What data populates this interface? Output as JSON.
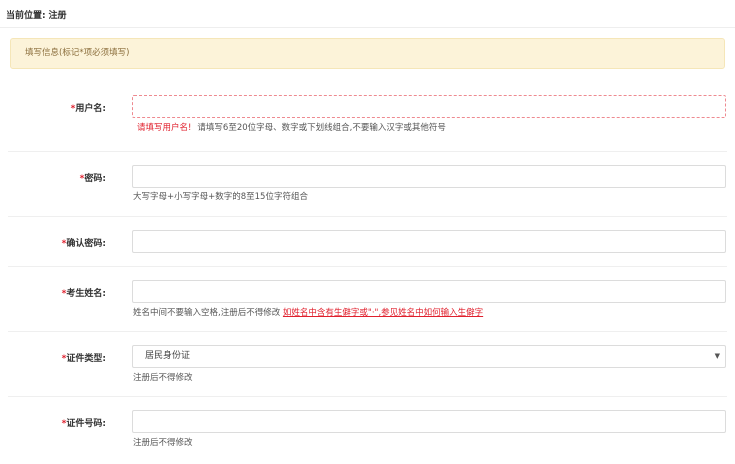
{
  "breadcrumb": {
    "label": "当前位置:",
    "page": "注册"
  },
  "notice": "填写信息(标记*项必须填写)",
  "required_mark": "*",
  "fields": {
    "username": {
      "label": "用户名:",
      "value": "",
      "error": "请填写用户名!",
      "help": "请填写6至20位字母、数字或下划线组合,不要输入汉字或其他符号"
    },
    "password": {
      "label": "密码:",
      "value": "",
      "help": "大写字母+小写字母+数字的8至15位字符组合"
    },
    "confirm_password": {
      "label": "确认密码:",
      "value": ""
    },
    "name": {
      "label": "考生姓名:",
      "value": "",
      "help": "姓名中间不要输入空格,注册后不得修改",
      "link": "如姓名中含有生僻字或\"·\",参见姓名中如何输入生僻字"
    },
    "id_type": {
      "label": "证件类型:",
      "selected": "居民身份证",
      "help": "注册后不得修改"
    },
    "id_number": {
      "label": "证件号码:",
      "value": "",
      "help": "注册后不得修改"
    }
  },
  "icons": {
    "dropdown": "chevron-down-icon"
  }
}
